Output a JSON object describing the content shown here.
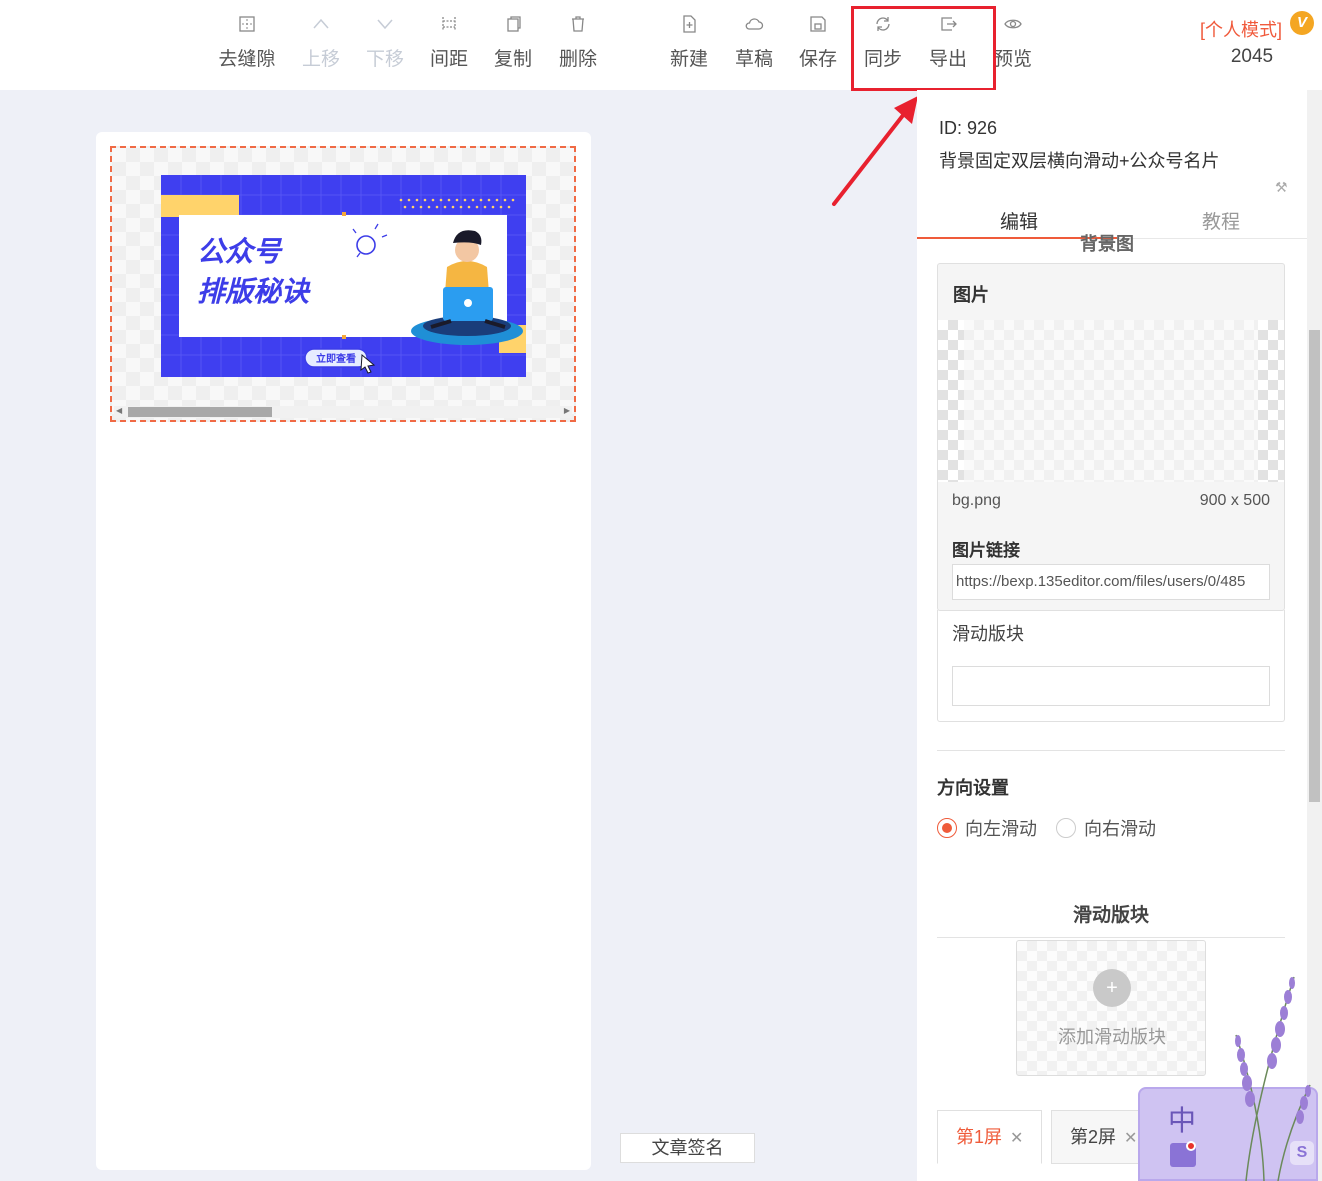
{
  "toolbar": {
    "items": [
      {
        "label": "去缝隙",
        "icon": "remove-gap-icon",
        "disabled": false
      },
      {
        "label": "上移",
        "icon": "chevron-up-icon",
        "disabled": true
      },
      {
        "label": "下移",
        "icon": "chevron-down-icon",
        "disabled": true
      },
      {
        "label": "间距",
        "icon": "spacing-icon",
        "disabled": false
      },
      {
        "label": "复制",
        "icon": "copy-icon",
        "disabled": false
      },
      {
        "label": "删除",
        "icon": "trash-icon",
        "disabled": false
      },
      {
        "label": "新建",
        "icon": "new-file-icon",
        "disabled": false
      },
      {
        "label": "草稿",
        "icon": "cloud-icon",
        "disabled": false
      },
      {
        "label": "保存",
        "icon": "save-icon",
        "disabled": false
      },
      {
        "label": "同步",
        "icon": "sync-icon",
        "disabled": false
      },
      {
        "label": "导出",
        "icon": "export-icon",
        "disabled": false
      },
      {
        "label": "预览",
        "icon": "eye-icon",
        "disabled": false
      }
    ],
    "mode_label": "[个人模式]",
    "vip_badge": "V",
    "count": "2045"
  },
  "canvas": {
    "banner": {
      "title_line1": "公众号",
      "title_line2": "排版秘诀",
      "button_label": "立即查看"
    },
    "signature_button": "文章签名"
  },
  "panel": {
    "id_label": "ID: 926",
    "template_name": "背景固定双层横向滑动+公众号名片",
    "tabs": {
      "edit": "编辑",
      "tutorial": "教程"
    },
    "cut_section_label": "背景图",
    "image_card": {
      "title": "图片",
      "filename": "bg.png",
      "dimensions": "900 x 500",
      "link_label": "图片链接",
      "link_value": "https://bexp.135editor.com/files/users/0/485"
    },
    "slide_card": {
      "title": "滑动版块",
      "value": ""
    },
    "direction": {
      "title": "方向设置",
      "options": [
        "向左滑动",
        "向右滑动"
      ],
      "selected": "向左滑动"
    },
    "slide_section_title": "滑动版块",
    "add_slide_label": "添加滑动版块",
    "screens": [
      {
        "label": "第1屏",
        "active": true
      },
      {
        "label": "第2屏",
        "active": false
      }
    ]
  },
  "ime": {
    "char": "中",
    "logo": "S"
  },
  "colors": {
    "accent": "#ef5b3a",
    "highlight": "#e8212f",
    "banner_blue": "#3d3de8",
    "banner_yellow": "#ffd36b"
  }
}
